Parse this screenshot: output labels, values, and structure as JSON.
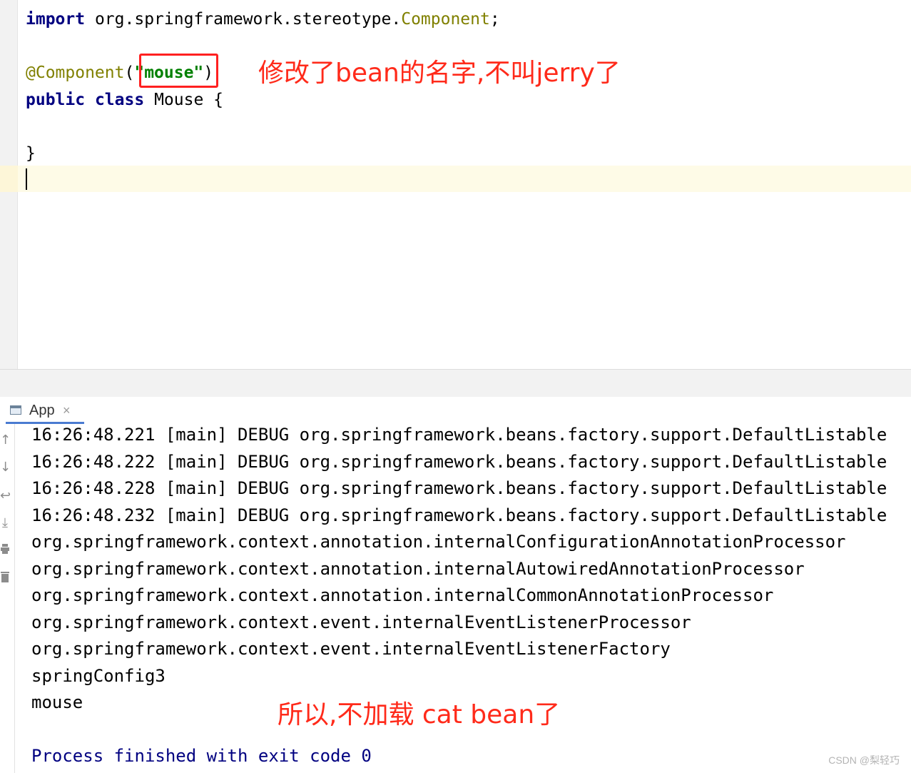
{
  "editor": {
    "line_import": {
      "keyword": "import",
      "path": "org.springframework.stereotype.",
      "class_name": "Component",
      "terminator": ";"
    },
    "line_annotation": {
      "annotation": "@Component",
      "open_paren": "(",
      "string_value": "\"mouse\"",
      "close_paren": ")"
    },
    "line_class": {
      "modifier": "public",
      "keyword": "class",
      "rest": "Mouse {"
    },
    "line_close": "}"
  },
  "annotations": {
    "editor_note": "修改了bean的名字,不叫jerry了",
    "console_note": "所以,不加载 cat bean了",
    "highlight_color": "#ff2a1a"
  },
  "run_panel": {
    "tab_label": "App",
    "tab_close": "×"
  },
  "toolbar_icons": [
    "up-arrow-icon",
    "down-arrow-icon",
    "soft-wrap-icon",
    "scroll-to-end-icon",
    "print-icon",
    "clear-icon"
  ],
  "console": {
    "lines": [
      "16:26:48.221 [main] DEBUG org.springframework.beans.factory.support.DefaultListable",
      "16:26:48.222 [main] DEBUG org.springframework.beans.factory.support.DefaultListable",
      "16:26:48.228 [main] DEBUG org.springframework.beans.factory.support.DefaultListable",
      "16:26:48.232 [main] DEBUG org.springframework.beans.factory.support.DefaultListable",
      "org.springframework.context.annotation.internalConfigurationAnnotationProcessor",
      "org.springframework.context.annotation.internalAutowiredAnnotationProcessor",
      "org.springframework.context.annotation.internalCommonAnnotationProcessor",
      "org.springframework.context.event.internalEventListenerProcessor",
      "org.springframework.context.event.internalEventListenerFactory",
      "springConfig3",
      "mouse"
    ],
    "exit_message": "Process finished with exit code 0"
  },
  "watermark": "CSDN @梨轻巧",
  "colors": {
    "keyword": "#000080",
    "annotation": "#808000",
    "string": "#008000",
    "caret_line": "#fefbe7",
    "tab_underline": "#4a7bd1"
  }
}
